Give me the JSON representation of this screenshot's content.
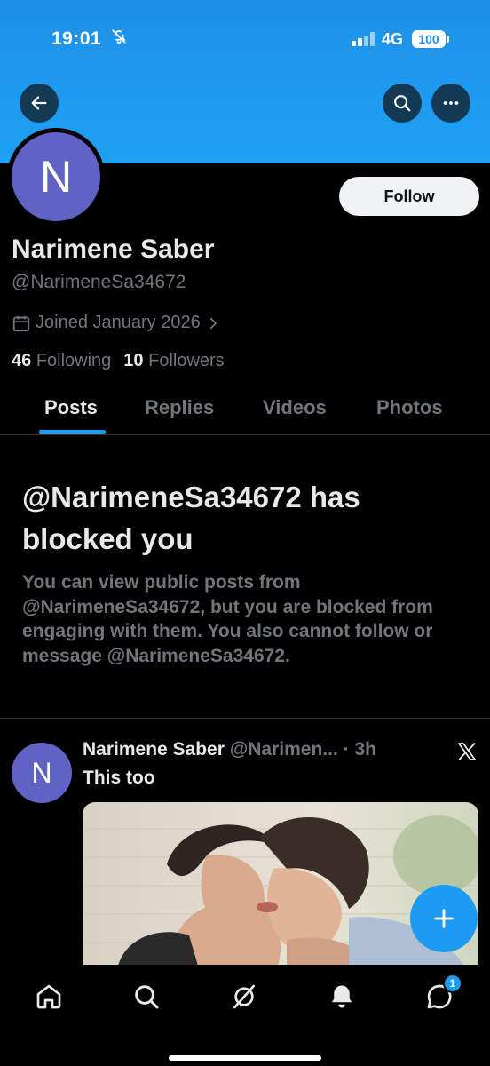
{
  "status_bar": {
    "time": "19:01",
    "network": "4G",
    "battery": "100"
  },
  "profile": {
    "avatar_letter": "N",
    "name": "Narimene Saber",
    "handle": "@NarimeneSa34672",
    "joined": "Joined January 2026",
    "following_count": "46",
    "following_label": "Following",
    "followers_count": "10",
    "followers_label": "Followers",
    "follow_label": "Follow"
  },
  "tabs": [
    {
      "label": "Posts",
      "active": true
    },
    {
      "label": "Replies",
      "active": false
    },
    {
      "label": "Videos",
      "active": false
    },
    {
      "label": "Photos",
      "active": false
    }
  ],
  "blocked": {
    "title": "@NarimeneSa34672 has blocked you",
    "body": "You can view public posts from @NarimeneSa34672, but you are blocked from engaging with them. You also cannot follow or message @NarimeneSa34672."
  },
  "post": {
    "avatar_letter": "N",
    "author": "Narimene Saber",
    "handle": "@Narimen...",
    "time": " · 3h",
    "text": "This too"
  },
  "nav": {
    "messages_badge": "1"
  },
  "icons": [
    "back-arrow-icon",
    "search-icon",
    "more-icon",
    "calendar-icon",
    "chevron-right-icon",
    "x-logo-icon",
    "plus-icon",
    "home-icon",
    "grok-icon",
    "bell-icon",
    "messages-icon"
  ],
  "colors": {
    "accent": "#1d9bf0",
    "banner": "#1e9bf0",
    "avatar": "#6163c4",
    "muted": "#71767b"
  }
}
